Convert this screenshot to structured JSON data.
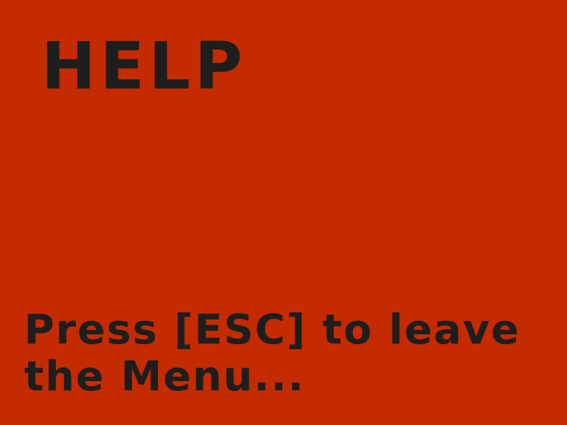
{
  "screen": {
    "title": "HELP",
    "hint_line1": "Press [ESC] to leave",
    "hint_line2": "the Menu..."
  },
  "colors": {
    "background": "#c42b00",
    "text": "#1e1e1e"
  }
}
